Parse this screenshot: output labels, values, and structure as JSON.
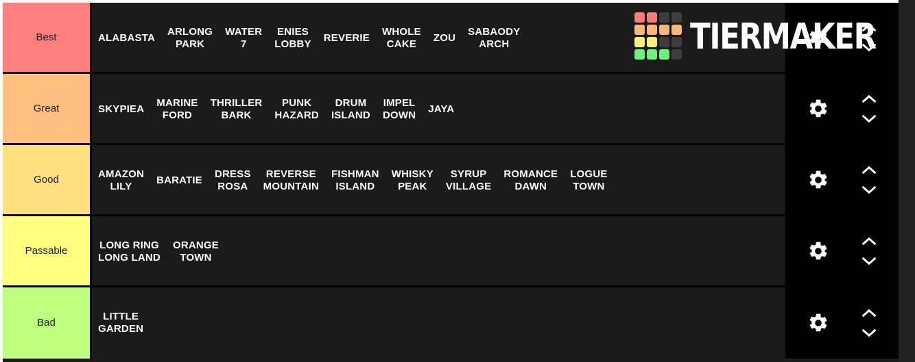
{
  "app": {
    "title": "TierMaker",
    "brand_text": "TIERMAKER",
    "logo_grid_colors": [
      "#f97b7b",
      "#f97b7b",
      "#3d3d3d",
      "#3d3d3d",
      "#f9b877",
      "#f9b877",
      "#f9b877",
      "#f9b877",
      "#f7f177",
      "#f7f177",
      "#3d3d3d",
      "#3d3d3d",
      "#6ef27a",
      "#6ef27a",
      "#6ef27a",
      "#3d3d3d"
    ],
    "background_color": "#1b1b1b",
    "row_background_color": "#1b1b1b",
    "controls_background_color": "#000000",
    "item_text_color": "#ffffff"
  },
  "controls": {
    "settings_label": "gear-icon",
    "move_up_label": "chevron-up-icon",
    "move_down_label": "chevron-down-icon"
  },
  "tiers": [
    {
      "label": "Best",
      "color": "#ff7f7f",
      "items": [
        "ALABASTA",
        "ARLONG\nPARK",
        "WATER\n7",
        "ENIES\nLOBBY",
        "REVERIE",
        "WHOLE\nCAKE",
        "ZOU",
        "SABAODY\nARCH"
      ]
    },
    {
      "label": "Great",
      "color": "#ffbf7f",
      "items": [
        "SKYPIEA",
        "MARINE\nFORD",
        "THRILLER\nBARK",
        "PUNK\nHAZARD",
        "DRUM\nISLAND",
        "IMPEL\nDOWN",
        "JAYA"
      ]
    },
    {
      "label": "Good",
      "color": "#ffdf7f",
      "items": [
        "AMAZON\nLILY",
        "BARATIE",
        "DRESS\nROSA",
        "REVERSE\nMOUNTAIN",
        "FISHMAN\nISLAND",
        "WHISKY\nPEAK",
        "SYRUP\nVILLAGE",
        "ROMANCE\nDAWN",
        "LOGUE\nTOWN"
      ]
    },
    {
      "label": "Passable",
      "color": "#ffff7f",
      "items": [
        "LONG RING\nLONG LAND",
        "ORANGE\nTOWN"
      ]
    },
    {
      "label": "Bad",
      "color": "#bfff7f",
      "items": [
        "LITTLE\nGARDEN"
      ]
    }
  ]
}
